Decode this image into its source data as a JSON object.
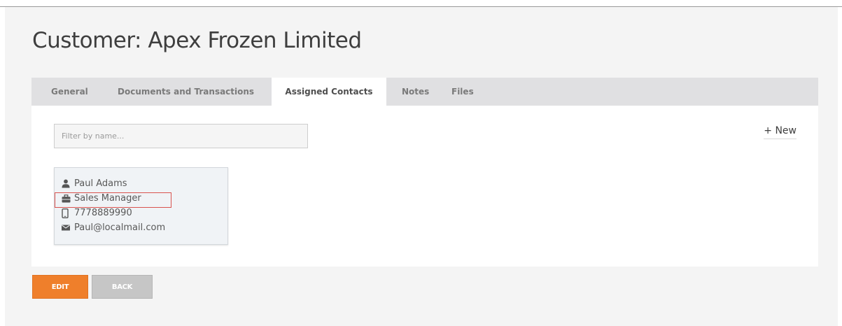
{
  "header": {
    "title": "Customer: Apex Frozen Limited"
  },
  "tabs": [
    {
      "label": "General",
      "active": false
    },
    {
      "label": "Documents and Transactions",
      "active": false
    },
    {
      "label": "Assigned Contacts",
      "active": true
    },
    {
      "label": "Notes",
      "active": false
    },
    {
      "label": "Files",
      "active": false
    }
  ],
  "filter": {
    "placeholder": "Filter by name...",
    "value": ""
  },
  "new_button": {
    "label": "+ New"
  },
  "contacts": [
    {
      "name": "Paul Adams",
      "name_icon": "user-icon",
      "title": "Sales Manager",
      "title_icon": "briefcase-icon",
      "phone": "7778889990",
      "phone_icon": "mobile-phone-icon",
      "email": "Paul@localmail.com",
      "email_icon": "envelope-icon"
    }
  ],
  "actions": {
    "edit_label": "EDIT",
    "back_label": "BACK"
  },
  "colors": {
    "accent": "#ef7f2b",
    "secondary_button": "#c6c6c6",
    "tab_bar": "#e0e0e2",
    "page_background": "#f4f4f4",
    "highlight": "#d9534f"
  }
}
